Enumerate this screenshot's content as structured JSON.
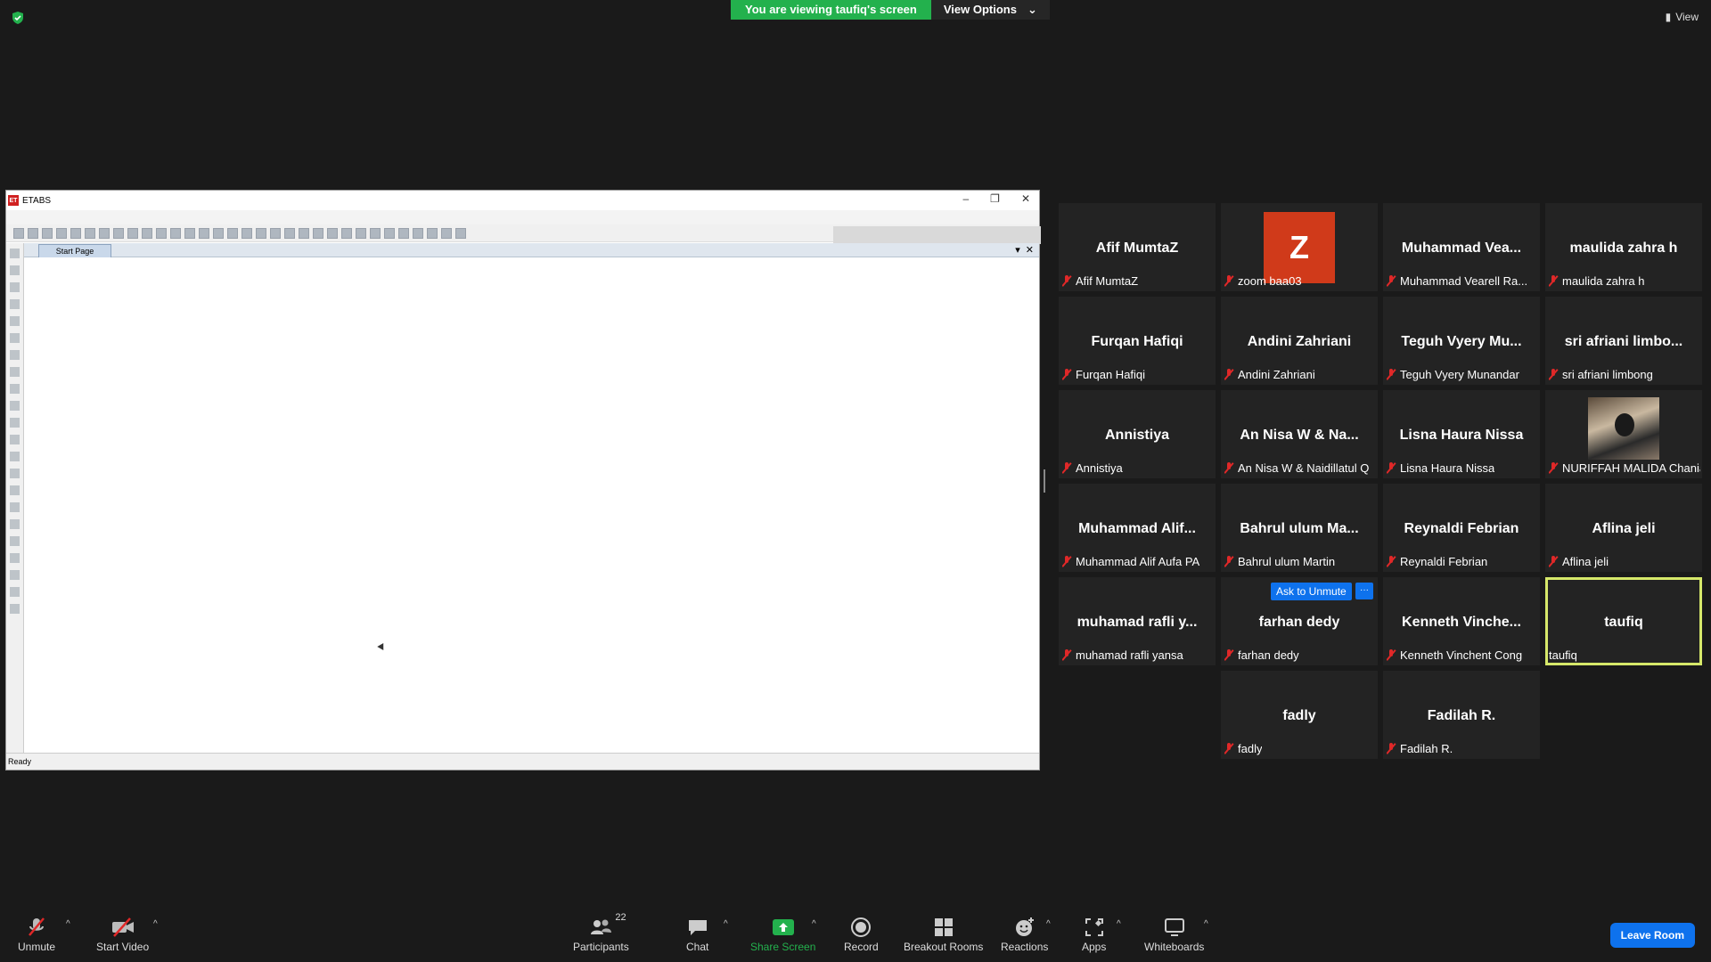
{
  "top": {
    "banner_text": "You are viewing taufiq's screen",
    "view_options_label": "View Options",
    "view_label": "View"
  },
  "etabs": {
    "title": "ETABS",
    "logo_text": "ET",
    "tab_label": "Start Page",
    "status": "Ready"
  },
  "participants": [
    {
      "name": "Afif MumtaZ",
      "label": "Afif MumtaZ",
      "muted": true
    },
    {
      "name": "",
      "label": "zoom baa03",
      "muted": true,
      "avatar": "Z"
    },
    {
      "name": "Muhammad  Vea...",
      "label": "Muhammad Vearell Ra...",
      "muted": true
    },
    {
      "name": "maulida zahra h",
      "label": "maulida zahra h",
      "muted": true
    },
    {
      "name": "Furqan Hafiqi",
      "label": "Furqan Hafiqi",
      "muted": true
    },
    {
      "name": "Andini Zahriani",
      "label": "Andini Zahriani",
      "muted": true
    },
    {
      "name": "Teguh  Vyery Mu...",
      "label": "Teguh Vyery Munandar",
      "muted": true
    },
    {
      "name": "sri  afriani limbo...",
      "label": "sri afriani limbong",
      "muted": true
    },
    {
      "name": "Annistiya",
      "label": "Annistiya",
      "muted": true
    },
    {
      "name": "An Nisa W & Na...",
      "label": "An Nisa W & Naidillatul Q",
      "muted": true
    },
    {
      "name": "Lisna Haura Nissa",
      "label": "Lisna Haura Nissa",
      "muted": true
    },
    {
      "name": "",
      "label": "NURIFFAH MALIDA Chania",
      "muted": true,
      "photo": true
    },
    {
      "name": "Muhammad  Alif...",
      "label": "Muhammad Alif Aufa PA",
      "muted": true
    },
    {
      "name": "Bahrul  ulum  Ma...",
      "label": "Bahrul ulum Martin",
      "muted": true
    },
    {
      "name": "Reynaldi Febrian",
      "label": "Reynaldi Febrian",
      "muted": true
    },
    {
      "name": "Aflina jeli",
      "label": "Aflina jeli",
      "muted": true
    },
    {
      "name": "muhamad  rafli  y...",
      "label": "muhamad rafli yansa",
      "muted": true
    },
    {
      "name": "farhan dedy",
      "label": "farhan dedy",
      "muted": true,
      "ask_unmute": "Ask to Unmute",
      "more": "···"
    },
    {
      "name": "Kenneth  Vinche...",
      "label": "Kenneth Vinchent Cong",
      "muted": true
    },
    {
      "name": "taufiq",
      "label": "taufiq",
      "muted": false,
      "active": true
    },
    {
      "empty": true
    },
    {
      "name": "fadly",
      "label": "fadly",
      "muted": true
    },
    {
      "name": "Fadilah R.",
      "label": "Fadilah R.",
      "muted": true
    }
  ],
  "toolbar": {
    "unmute": "Unmute",
    "start_video": "Start Video",
    "participants": "Participants",
    "participants_count": "22",
    "chat": "Chat",
    "share_screen": "Share Screen",
    "record": "Record",
    "breakout_rooms": "Breakout Rooms",
    "reactions": "Reactions",
    "apps": "Apps",
    "whiteboards": "Whiteboards",
    "leave_room": "Leave Room"
  },
  "colors": {
    "banner_green": "#23b14d",
    "zoom_blue": "#0e72ed",
    "mute_red": "#e02828",
    "active_border": "#d6e86a",
    "avatar_z": "#d03a1a"
  }
}
